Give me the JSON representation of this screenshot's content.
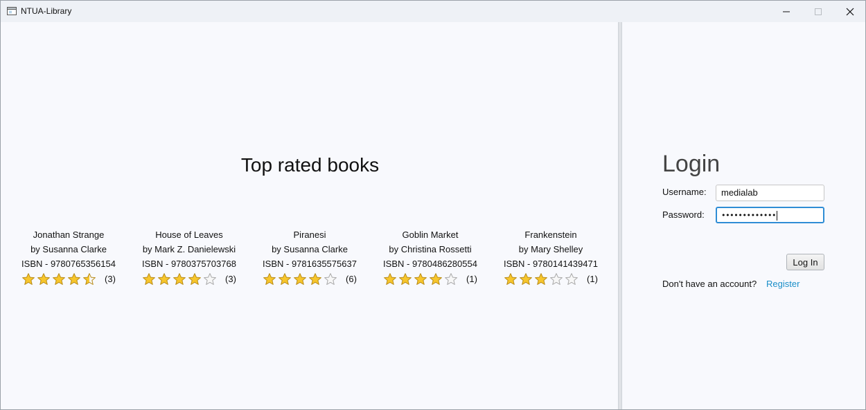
{
  "window": {
    "title": "NTUA-Library",
    "icon": "app-window-icon",
    "controls": [
      "minimize-icon",
      "maximize-icon",
      "close-icon"
    ]
  },
  "main": {
    "heading": "Top rated books",
    "books": [
      {
        "title": "Jonathan Strange",
        "author": "by Susanna Clarke",
        "isbn": "ISBN - 9780765356154",
        "rating": 4.5,
        "rating_count": "(3)"
      },
      {
        "title": "House of Leaves",
        "author": "by Mark Z. Danielewski",
        "isbn": "ISBN - 9780375703768",
        "rating": 4,
        "rating_count": "(3)"
      },
      {
        "title": "Piranesi",
        "author": "by Susanna Clarke",
        "isbn": "ISBN - 9781635575637",
        "rating": 4,
        "rating_count": "(6)"
      },
      {
        "title": "Goblin Market",
        "author": "by Christina Rossetti",
        "isbn": "ISBN - 9780486280554",
        "rating": 4,
        "rating_count": "(1)"
      },
      {
        "title": "Frankenstein",
        "author": "by Mary Shelley",
        "isbn": "ISBN - 9780141439471",
        "rating": 3,
        "rating_count": "(1)"
      }
    ]
  },
  "login": {
    "title": "Login",
    "username_label": "Username:",
    "username_value": "medialab",
    "password_label": "Password:",
    "password_value": "•••••••••••••",
    "login_button": "Log In",
    "no_account_text": "Don't have an account?",
    "register_link": "Register"
  },
  "colors": {
    "accent": "#2f8dd5",
    "link": "#1a8ec8",
    "star_fill": "#f7c62c",
    "star_empty": "#f7f7f7"
  }
}
